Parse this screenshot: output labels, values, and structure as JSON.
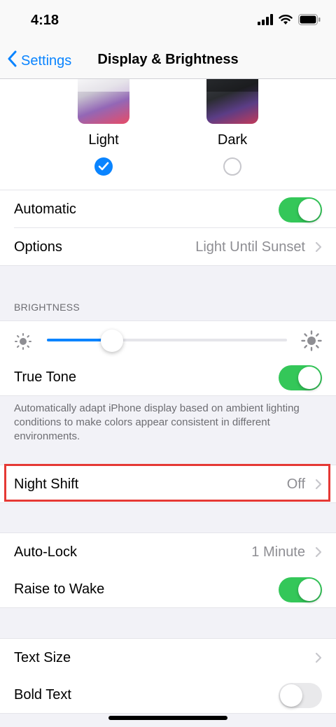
{
  "status_bar": {
    "time": "4:18"
  },
  "nav": {
    "back_label": "Settings",
    "title": "Display & Brightness"
  },
  "appearance": {
    "light_label": "Light",
    "dark_label": "Dark",
    "selected": "Light"
  },
  "rows": {
    "automatic": {
      "label": "Automatic",
      "toggle": "on"
    },
    "options": {
      "label": "Options",
      "value": "Light Until Sunset"
    },
    "true_tone": {
      "label": "True Tone",
      "toggle": "on"
    },
    "night_shift": {
      "label": "Night Shift",
      "value": "Off"
    },
    "auto_lock": {
      "label": "Auto-Lock",
      "value": "1 Minute"
    },
    "raise_to_wake": {
      "label": "Raise to Wake",
      "toggle": "on"
    },
    "text_size": {
      "label": "Text Size"
    },
    "bold_text": {
      "label": "Bold Text",
      "toggle": "off"
    }
  },
  "brightness": {
    "header": "BRIGHTNESS",
    "level": 0.27,
    "footer": "Automatically adapt iPhone display based on ambient lighting conditions to make colors appear consistent in different environments."
  },
  "colors": {
    "accent": "#0a84ff",
    "toggle_on": "#34c759",
    "highlight": "#e53935"
  }
}
